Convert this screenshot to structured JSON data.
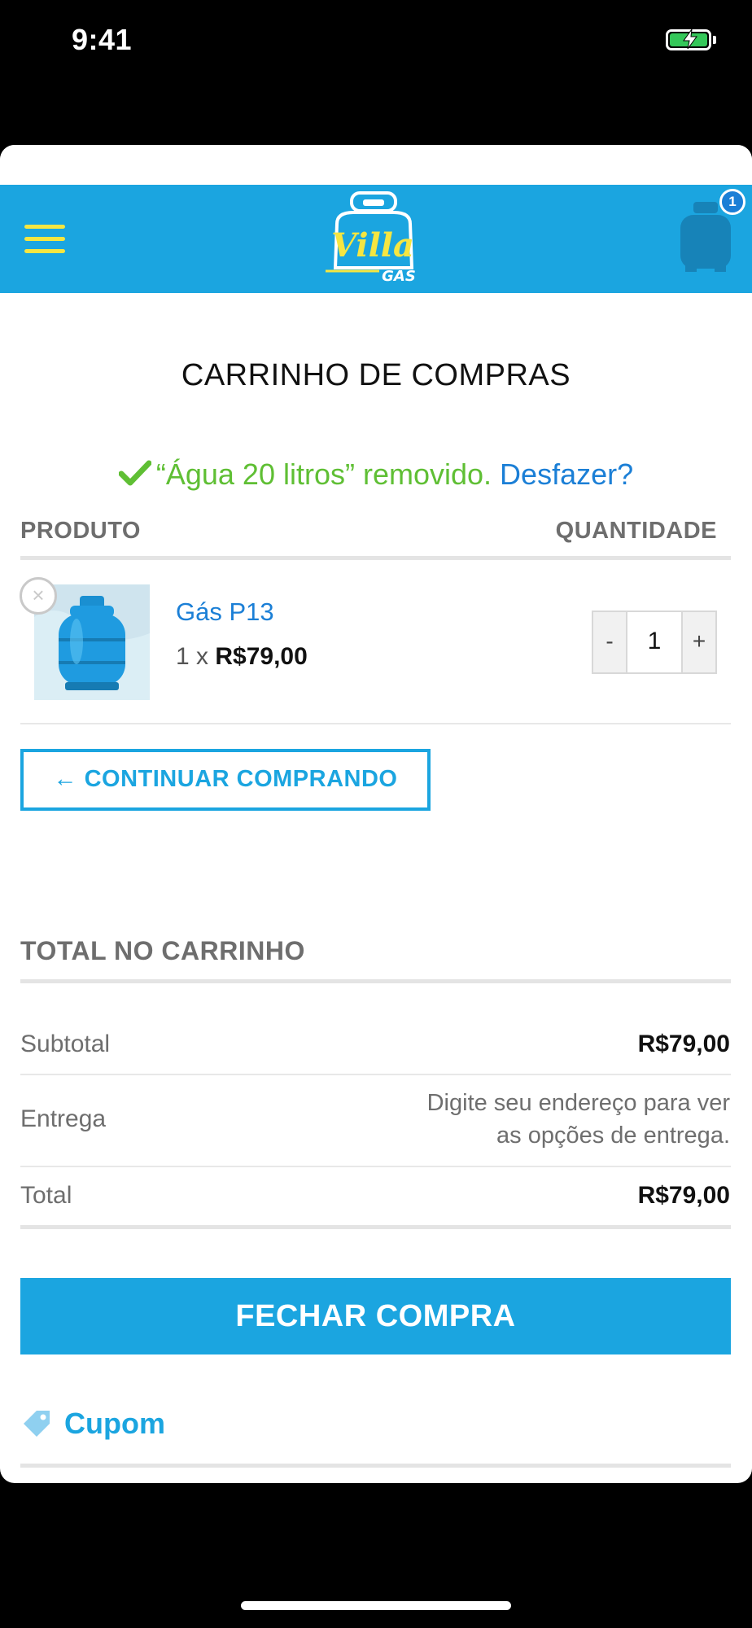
{
  "status_bar": {
    "time": "9:41"
  },
  "header": {
    "menu_icon": "hamburger-icon",
    "logo_line1": "Villa",
    "logo_line2": "GÁS",
    "cart_icon": "gas-cylinder-icon",
    "cart_count": "1",
    "colors": {
      "header_bg": "#1ba5e0",
      "accent_yellow": "#f5e641"
    }
  },
  "page": {
    "title": "CARRINHO DE COMPRAS",
    "notice": {
      "message": "“Água 20 litros” removido.",
      "undo_label": "Desfazer?",
      "icon": "check-icon"
    },
    "table": {
      "col_product": "PRODUTO",
      "col_quantity": "QUANTIDADE",
      "items": [
        {
          "name": "Gás P13",
          "qty_prefix": "1 x",
          "price": "R$79,00",
          "quantity": "1",
          "decrement": "-",
          "increment": "+",
          "remove_icon": "remove-icon"
        }
      ]
    },
    "continue_label": "← CONTINUAR COMPRANDO"
  },
  "totals": {
    "title": "TOTAL NO CARRINHO",
    "subtotal_label": "Subtotal",
    "subtotal_value": "R$79,00",
    "shipping_label": "Entrega",
    "shipping_line1": "Digite seu endereço para ver",
    "shipping_line2": "as opções de entrega.",
    "total_label": "Total",
    "total_value": "R$79,00"
  },
  "checkout_label": "FECHAR COMPRA",
  "coupon": {
    "label": "Cupom",
    "icon": "tag-icon"
  }
}
